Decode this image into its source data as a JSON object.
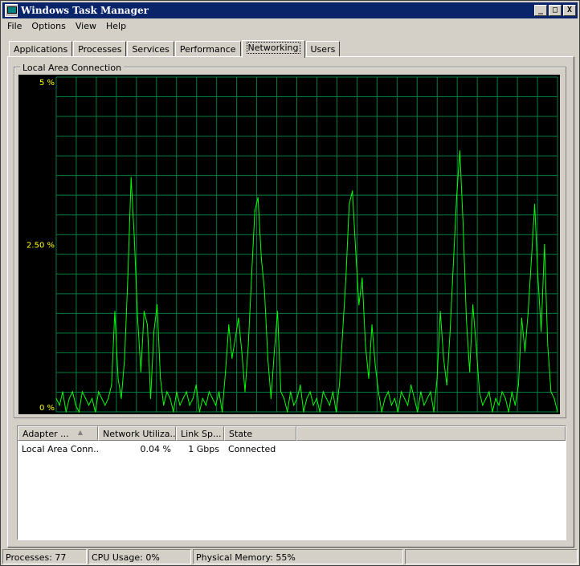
{
  "window": {
    "title": "Windows Task Manager"
  },
  "title_buttons": {
    "minimize": "_",
    "maximize": "□",
    "close": "X"
  },
  "menu": [
    "File",
    "Options",
    "View",
    "Help"
  ],
  "tabs": [
    {
      "label": "Applications",
      "active": false
    },
    {
      "label": "Processes",
      "active": false
    },
    {
      "label": "Services",
      "active": false
    },
    {
      "label": "Performance",
      "active": false
    },
    {
      "label": "Networking",
      "active": true
    },
    {
      "label": "Users",
      "active": false
    }
  ],
  "graph_group": {
    "label": "Local Area Connection"
  },
  "chart_data": {
    "type": "line",
    "ylim": [
      0,
      5
    ],
    "y_tick_labels": [
      "5 %",
      "2.50 %",
      "0 %"
    ],
    "grid": true,
    "colors": {
      "background": "#000000",
      "grid": "#008040",
      "line": "#00ff00",
      "labels": "#ffff00"
    },
    "series": [
      {
        "values": [
          0.2,
          0.1,
          0.3,
          0.0,
          0.2,
          0.3,
          0.1,
          0.0,
          0.3,
          0.2,
          0.1,
          0.2,
          0.0,
          0.3,
          0.2,
          0.1,
          0.2,
          0.4,
          1.5,
          0.5,
          0.2,
          0.8,
          2.0,
          3.5,
          2.6,
          1.4,
          0.6,
          1.5,
          1.3,
          0.2,
          1.2,
          1.6,
          0.5,
          0.1,
          0.3,
          0.2,
          0.0,
          0.3,
          0.1,
          0.2,
          0.3,
          0.1,
          0.2,
          0.4,
          0.0,
          0.2,
          0.1,
          0.3,
          0.2,
          0.1,
          0.3,
          0.0,
          0.6,
          1.3,
          0.8,
          1.1,
          1.4,
          0.9,
          0.3,
          1.0,
          2.0,
          3.0,
          3.2,
          2.3,
          1.8,
          0.8,
          0.2,
          0.9,
          1.5,
          0.3,
          0.2,
          0.0,
          0.3,
          0.1,
          0.2,
          0.4,
          0.0,
          0.2,
          0.3,
          0.1,
          0.2,
          0.0,
          0.3,
          0.2,
          0.1,
          0.3,
          0.0,
          0.4,
          1.2,
          2.0,
          3.1,
          3.3,
          2.4,
          1.6,
          2.0,
          1.0,
          0.5,
          1.3,
          0.7,
          0.3,
          0.0,
          0.2,
          0.3,
          0.1,
          0.2,
          0.0,
          0.3,
          0.2,
          0.1,
          0.4,
          0.2,
          0.0,
          0.3,
          0.1,
          0.2,
          0.3,
          0.0,
          0.5,
          1.5,
          0.8,
          0.4,
          1.2,
          2.2,
          3.2,
          3.9,
          2.8,
          1.4,
          0.6,
          1.6,
          1.0,
          0.3,
          0.1,
          0.2,
          0.3,
          0.0,
          0.2,
          0.1,
          0.3,
          0.2,
          0.0,
          0.3,
          0.1,
          0.4,
          1.4,
          0.9,
          1.5,
          2.3,
          3.1,
          2.0,
          1.2,
          2.5,
          1.0,
          0.3,
          0.2,
          0.0
        ],
        "ylim": [
          0,
          5
        ]
      }
    ]
  },
  "adapter_table": {
    "columns": [
      "Adapter ...",
      "Network Utiliza...",
      "Link Sp...",
      "State"
    ],
    "rows": [
      [
        "Local Area Conn...",
        "0.04 %",
        "1 Gbps",
        "Connected"
      ]
    ]
  },
  "status": {
    "processes": "Processes: 77",
    "cpu": "CPU Usage: 0%",
    "memory": "Physical Memory: 55%"
  }
}
